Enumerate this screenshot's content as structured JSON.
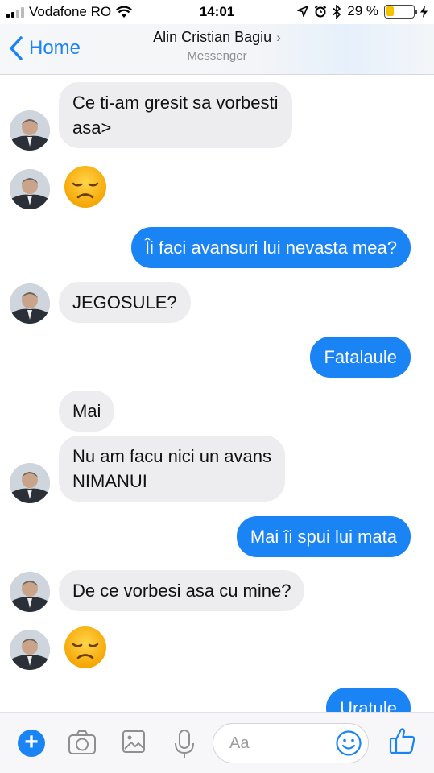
{
  "status_bar": {
    "carrier": "Vodafone RO",
    "time": "14:01",
    "battery_percent": "29 %",
    "battery_level": 0.29,
    "battery_color": "#f5c200"
  },
  "nav": {
    "back_label": "Home",
    "contact_name": "Alin Cristian Bagiu",
    "subtitle": "Messenger"
  },
  "messages": [
    {
      "side": "in",
      "text": "Ce ti-am gresit sa vorbesti\nasa>"
    },
    {
      "side": "in",
      "emoji": "disappointed-face"
    },
    {
      "side": "out",
      "text": "Îi faci avansuri lui nevasta mea?"
    },
    {
      "side": "in",
      "text": "JEGOSULE?"
    },
    {
      "side": "out",
      "text": "Fatalaule"
    },
    {
      "side": "in",
      "text": "Mai"
    },
    {
      "side": "in",
      "text": "Nu am facu nici un avans\nNIMANUI"
    },
    {
      "side": "out",
      "text": "Mai îi spui lui mata"
    },
    {
      "side": "in",
      "text": "De ce vorbesi asa cu mine?"
    },
    {
      "side": "in",
      "emoji": "disappointed-face"
    },
    {
      "side": "out",
      "text": "Uratule"
    }
  ],
  "composer": {
    "placeholder": "Aa",
    "icons": [
      "plus-icon",
      "camera-icon",
      "gallery-icon",
      "microphone-icon",
      "emoji-icon",
      "like-icon"
    ]
  },
  "colors": {
    "accent": "#1a84f5",
    "incoming_bubble": "#ededef",
    "outgoing_bubble": "#1a84f5"
  }
}
